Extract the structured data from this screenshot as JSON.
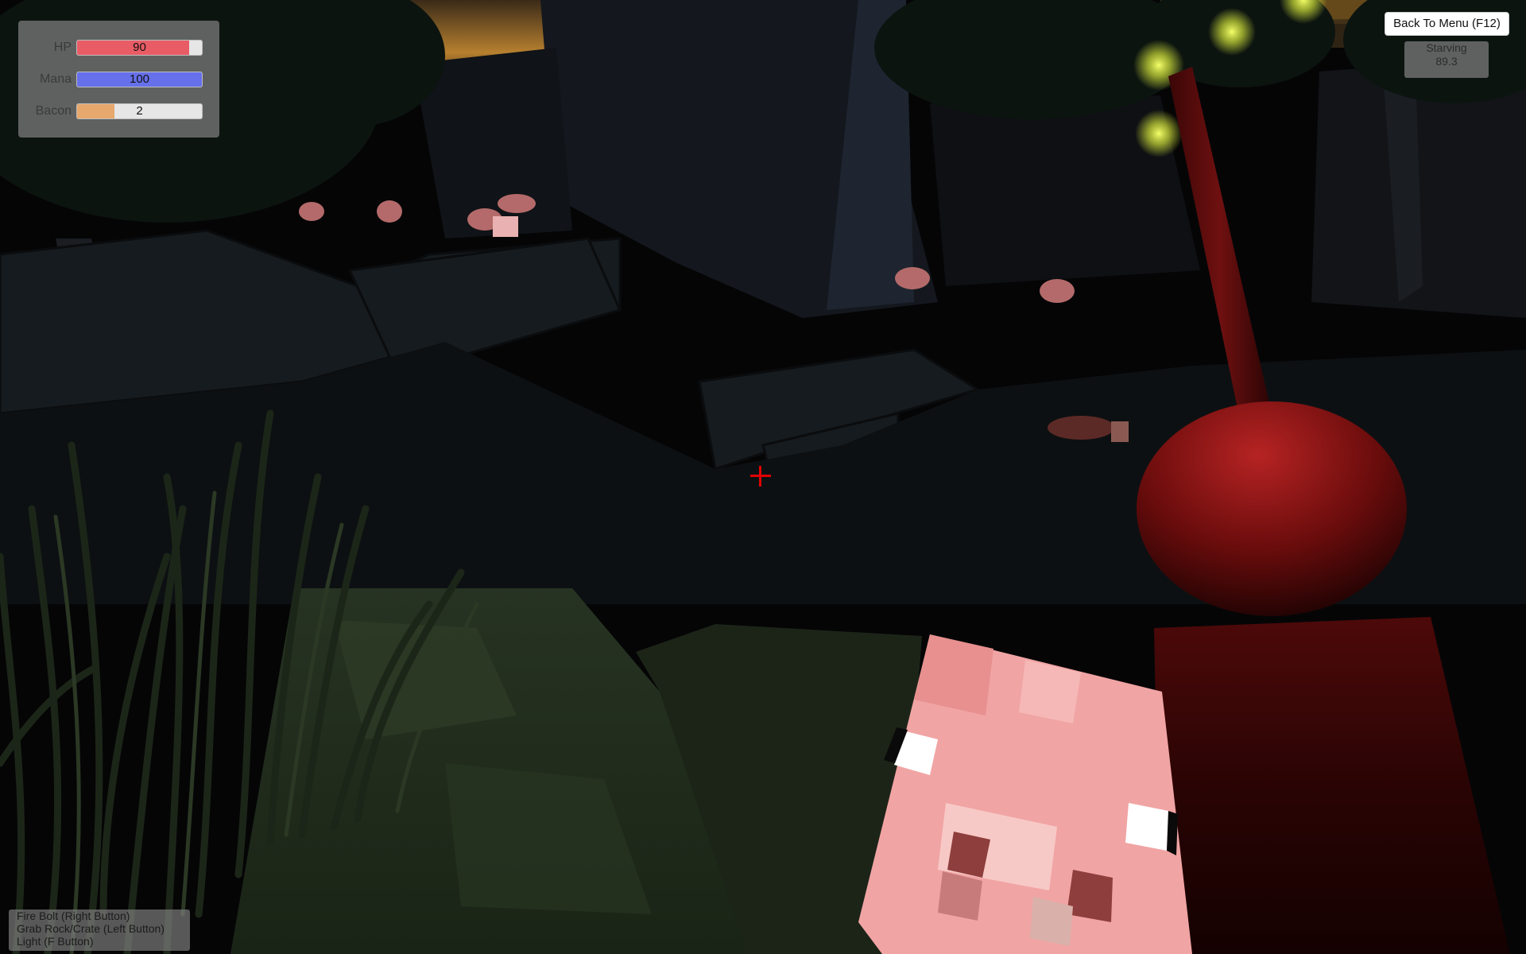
{
  "hud": {
    "stats": [
      {
        "label": "HP",
        "value": "90",
        "fraction": 0.9,
        "color": "#e85c65"
      },
      {
        "label": "Mana",
        "value": "100",
        "fraction": 1.0,
        "color": "#6670ea"
      },
      {
        "label": "Bacon",
        "value": "2",
        "fraction": 0.3,
        "color": "#e7a86d"
      }
    ],
    "menu_button_label": "Back To Menu (F12)",
    "status": {
      "label": "Starving",
      "value": "89.3"
    },
    "controls": [
      "Fire Bolt (Right Button)",
      "Grab Rock/Crate (Left Button)",
      "Light (F Button)"
    ]
  },
  "colors": {
    "crosshair": "#e00000",
    "sky": "#b7802f",
    "ground": "#2d3a26",
    "pig": "#f2a3a3",
    "torch": "#8b1313",
    "firefly": "#e6f24b"
  }
}
